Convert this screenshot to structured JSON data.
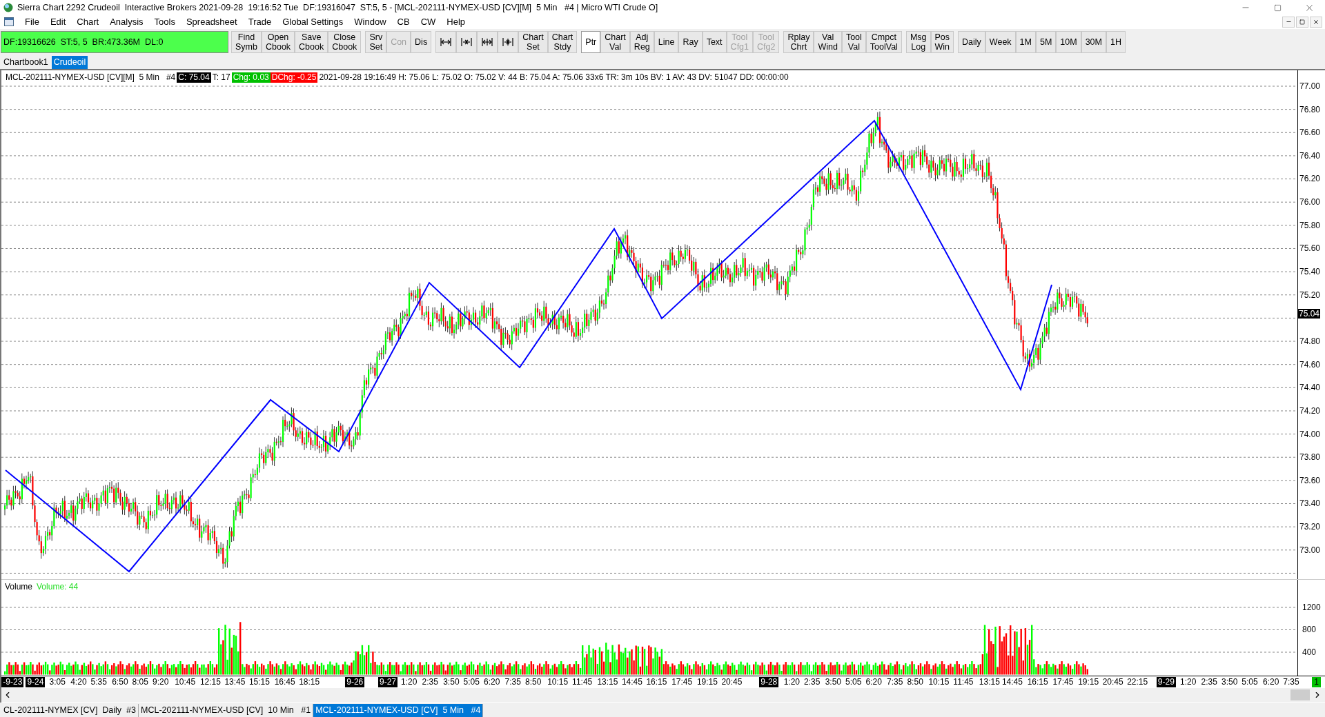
{
  "window": {
    "title": "Sierra Chart 2292 Crudeoil  Interactive Brokers 2021-09-28  19:16:52 Tue  DF:19316047  ST:5, 5 - [MCL-202111-NYMEX-USD [CV][M]  5 Min   #4 | Micro WTI Crude O]"
  },
  "menu": [
    "File",
    "Edit",
    "Chart",
    "Analysis",
    "Tools",
    "Spreadsheet",
    "Trade",
    "Global Settings",
    "Window",
    "CB",
    "CW",
    "Help"
  ],
  "status_box": {
    "text": "DF:19316626  ST:5, 5  BR:473.36M  DL:0"
  },
  "toolbar": [
    [
      {
        "kind": "text",
        "lines": [
          "Find",
          "Symb"
        ],
        "disabled": false,
        "selected": false
      },
      {
        "kind": "text",
        "lines": [
          "Open",
          "Cbook"
        ],
        "disabled": false,
        "selected": false
      },
      {
        "kind": "text",
        "lines": [
          "Save",
          "Cbook"
        ],
        "disabled": false,
        "selected": false
      },
      {
        "kind": "text",
        "lines": [
          "Close",
          "Cbook"
        ],
        "disabled": false,
        "selected": false
      }
    ],
    [
      {
        "kind": "text",
        "lines": [
          "Srv",
          "Set"
        ],
        "disabled": false,
        "selected": false
      },
      {
        "kind": "text",
        "lines": [
          "Con"
        ],
        "disabled": true,
        "selected": false
      },
      {
        "kind": "text",
        "lines": [
          "Dis"
        ],
        "disabled": false,
        "selected": false
      }
    ],
    [
      {
        "kind": "icon",
        "disabled": false,
        "selected": false
      },
      {
        "kind": "icon",
        "disabled": false,
        "selected": false
      },
      {
        "kind": "icon",
        "disabled": false,
        "selected": false
      },
      {
        "kind": "icon",
        "disabled": false,
        "selected": false
      },
      {
        "kind": "text",
        "lines": [
          "Chart",
          "Set"
        ],
        "disabled": false,
        "selected": false
      },
      {
        "kind": "text",
        "lines": [
          "Chart",
          "Stdy"
        ],
        "disabled": false,
        "selected": false
      }
    ],
    [
      {
        "kind": "text",
        "lines": [
          "Ptr"
        ],
        "disabled": false,
        "selected": true
      },
      {
        "kind": "text",
        "lines": [
          "Chart",
          "Val"
        ],
        "disabled": false,
        "selected": false
      },
      {
        "kind": "text",
        "lines": [
          "Adj",
          "Reg"
        ],
        "disabled": false,
        "selected": false
      },
      {
        "kind": "text",
        "lines": [
          "Line"
        ],
        "disabled": false,
        "selected": false
      },
      {
        "kind": "text",
        "lines": [
          "Ray"
        ],
        "disabled": false,
        "selected": false
      },
      {
        "kind": "text",
        "lines": [
          "Text"
        ],
        "disabled": false,
        "selected": false
      },
      {
        "kind": "text",
        "lines": [
          "Tool",
          "Cfg1"
        ],
        "disabled": true,
        "selected": false
      },
      {
        "kind": "text",
        "lines": [
          "Tool",
          "Cfg2"
        ],
        "disabled": true,
        "selected": false
      }
    ],
    [
      {
        "kind": "text",
        "lines": [
          "Rplay",
          "Chrt"
        ],
        "disabled": false,
        "selected": false
      },
      {
        "kind": "text",
        "lines": [
          "Val",
          "Wind"
        ],
        "disabled": false,
        "selected": false
      },
      {
        "kind": "text",
        "lines": [
          "Tool",
          "Val"
        ],
        "disabled": false,
        "selected": false
      },
      {
        "kind": "text",
        "lines": [
          "Cmpct",
          "ToolVal"
        ],
        "disabled": false,
        "selected": false
      }
    ],
    [
      {
        "kind": "text",
        "lines": [
          "Msg",
          "Log"
        ],
        "disabled": false,
        "selected": false
      },
      {
        "kind": "text",
        "lines": [
          "Pos",
          "Win"
        ],
        "disabled": false,
        "selected": false
      }
    ],
    [
      {
        "kind": "text",
        "lines": [
          "Daily"
        ],
        "disabled": false,
        "selected": false
      },
      {
        "kind": "text",
        "lines": [
          "Week"
        ],
        "disabled": false,
        "selected": false
      },
      {
        "kind": "text",
        "lines": [
          "1M"
        ],
        "disabled": false,
        "selected": false
      },
      {
        "kind": "text",
        "lines": [
          "5M"
        ],
        "disabled": false,
        "selected": false
      },
      {
        "kind": "text",
        "lines": [
          "10M"
        ],
        "disabled": false,
        "selected": false
      },
      {
        "kind": "text",
        "lines": [
          "30M"
        ],
        "disabled": false,
        "selected": false
      },
      {
        "kind": "text",
        "lines": [
          "1H"
        ],
        "disabled": false,
        "selected": false
      }
    ]
  ],
  "chartbook_tabs": [
    {
      "label": "Chartbook1",
      "selected": false
    },
    {
      "label": "Crudeoil",
      "selected": true
    }
  ],
  "chart": {
    "header": [
      {
        "text": "MCL-202111-NYMEX-USD [CV][M]  5 Min   #4"
      },
      {
        "text": "C: 75.04",
        "color": "#000000"
      },
      {
        "text": "T: 17"
      },
      {
        "text": "Chg: 0.03",
        "color": "#00c000"
      },
      {
        "text": "DChg: -0.25",
        "color": "#ff0000"
      },
      {
        "text": "2021-09-28 19:16:49 H: 75.06 L: 75.02 O: 75.02 V: 44 B: 75.04 A: 75.06 33x6 TR: 3m 10s BV: 1 AV: 43 DV: 51047 DD: 00:00:00"
      }
    ],
    "price_axis": [
      "77.00",
      "76.80",
      "76.60",
      "76.40",
      "76.20",
      "76.00",
      "75.80",
      "75.60",
      "75.40",
      "75.20",
      "74.80",
      "74.60",
      "74.40",
      "74.20",
      "74.00",
      "73.80",
      "73.60",
      "73.40",
      "73.20",
      "73.00"
    ],
    "current_price": "75.04",
    "volume_study": {
      "name": "Volume",
      "value": "Volume: 44"
    },
    "volume_axis": [
      "1200",
      "800",
      "400"
    ],
    "x_axis": [
      {
        "label": "-9-23",
        "kind": "date"
      },
      {
        "label": "9-24",
        "kind": "date"
      },
      {
        "label": "3:05",
        "kind": "time"
      },
      {
        "label": "4:20",
        "kind": "time"
      },
      {
        "label": "5:35",
        "kind": "time"
      },
      {
        "label": "6:50",
        "kind": "time"
      },
      {
        "label": "8:05",
        "kind": "time"
      },
      {
        "label": "9:20",
        "kind": "time"
      },
      {
        "label": "10:45",
        "kind": "time"
      },
      {
        "label": "12:15",
        "kind": "time"
      },
      {
        "label": "13:45",
        "kind": "time"
      },
      {
        "label": "15:15",
        "kind": "time"
      },
      {
        "label": "16:45",
        "kind": "time"
      },
      {
        "label": "18:15",
        "kind": "time"
      },
      {
        "label": "9-26",
        "kind": "date"
      },
      {
        "label": "9-27",
        "kind": "date"
      },
      {
        "label": "1:20",
        "kind": "time"
      },
      {
        "label": "2:35",
        "kind": "time"
      },
      {
        "label": "3:50",
        "kind": "time"
      },
      {
        "label": "5:05",
        "kind": "time"
      },
      {
        "label": "6:20",
        "kind": "time"
      },
      {
        "label": "7:35",
        "kind": "time"
      },
      {
        "label": "8:50",
        "kind": "time"
      },
      {
        "label": "10:15",
        "kind": "time"
      },
      {
        "label": "11:45",
        "kind": "time"
      },
      {
        "label": "13:15",
        "kind": "time"
      },
      {
        "label": "14:45",
        "kind": "time"
      },
      {
        "label": "16:15",
        "kind": "time"
      },
      {
        "label": "17:45",
        "kind": "time"
      },
      {
        "label": "19:15",
        "kind": "time"
      },
      {
        "label": "20:45",
        "kind": "time"
      },
      {
        "label": "9-28",
        "kind": "date"
      },
      {
        "label": "1:20",
        "kind": "time"
      },
      {
        "label": "2:35",
        "kind": "time"
      },
      {
        "label": "3:50",
        "kind": "time"
      },
      {
        "label": "5:05",
        "kind": "time"
      },
      {
        "label": "6:20",
        "kind": "time"
      },
      {
        "label": "7:35",
        "kind": "time"
      },
      {
        "label": "8:50",
        "kind": "time"
      },
      {
        "label": "10:15",
        "kind": "time"
      },
      {
        "label": "11:45",
        "kind": "time"
      },
      {
        "label": "13:15",
        "kind": "time"
      },
      {
        "label": "14:45",
        "kind": "time"
      },
      {
        "label": "16:15",
        "kind": "time"
      },
      {
        "label": "17:45",
        "kind": "time"
      },
      {
        "label": "19:15",
        "kind": "time"
      },
      {
        "label": "20:45",
        "kind": "time"
      },
      {
        "label": "22:15",
        "kind": "time"
      },
      {
        "label": "9-29",
        "kind": "date"
      },
      {
        "label": "1:20",
        "kind": "time"
      },
      {
        "label": "2:35",
        "kind": "time"
      },
      {
        "label": "3:50",
        "kind": "time"
      },
      {
        "label": "5:05",
        "kind": "time"
      },
      {
        "label": "6:20",
        "kind": "time"
      },
      {
        "label": "7:35",
        "kind": "time"
      }
    ],
    "corner_badge": "1"
  },
  "chart_tabs": [
    {
      "label": "CL-202111-NYMEX [CV]  Daily  #3",
      "selected": false
    },
    {
      "label": "MCL-202111-NYMEX-USD [CV]  10 Min   #1",
      "selected": false
    },
    {
      "label": "MCL-202111-NYMEX-USD [CV]  5 Min   #4",
      "selected": true
    }
  ]
}
